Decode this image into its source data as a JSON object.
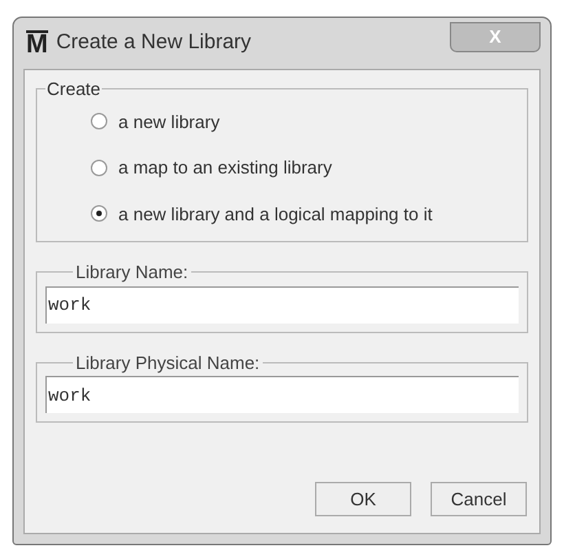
{
  "window": {
    "logo": "M",
    "title": "Create a New Library",
    "close": "X"
  },
  "create_group": {
    "legend": "Create",
    "options": [
      {
        "label": "a new library",
        "selected": false
      },
      {
        "label": "a map to an existing library",
        "selected": false
      },
      {
        "label": "a new library and a logical mapping to it",
        "selected": true
      }
    ]
  },
  "fields": [
    {
      "legend": "Library Name:",
      "value": "work"
    },
    {
      "legend": "Library Physical Name:",
      "value": "work"
    }
  ],
  "buttons": [
    "OK",
    "Cancel"
  ]
}
